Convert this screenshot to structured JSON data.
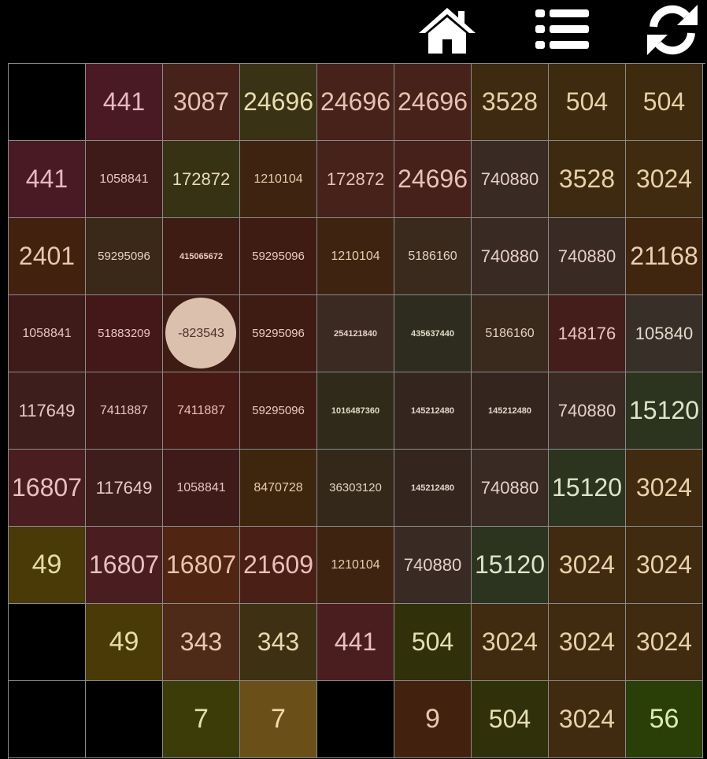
{
  "toolbar": {
    "buttons": [
      {
        "name": "home-button",
        "icon": "home-icon"
      },
      {
        "name": "menu-button",
        "icon": "list-icon"
      },
      {
        "name": "restart-button",
        "icon": "refresh-icon"
      }
    ],
    "icon_color": "#ffffff"
  },
  "board": {
    "rows": 9,
    "cols": 9,
    "selected": {
      "row": 3,
      "col": 2
    },
    "selected_color": "#dcc0ae",
    "cells": [
      [
        {
          "v": "",
          "bg": "#000000",
          "fg": "#e8c8c0"
        },
        {
          "v": "441",
          "bg": "#4a1a24",
          "fg": "#e8b8c0"
        },
        {
          "v": "3087",
          "bg": "#46221a",
          "fg": "#e8c0b0"
        },
        {
          "v": "24696",
          "bg": "#3a3214",
          "fg": "#e8dcb0"
        },
        {
          "v": "24696",
          "bg": "#46221a",
          "fg": "#e8c0b0"
        },
        {
          "v": "24696",
          "bg": "#46221a",
          "fg": "#e8c0b0"
        },
        {
          "v": "3528",
          "bg": "#3e2a10",
          "fg": "#e8d0a8"
        },
        {
          "v": "504",
          "bg": "#3e2a0e",
          "fg": "#e8d0a8"
        },
        {
          "v": "504",
          "bg": "#3e2a0e",
          "fg": "#e8d0a8"
        }
      ],
      [
        {
          "v": "441",
          "bg": "#4a1a24",
          "fg": "#e8b8c0"
        },
        {
          "v": "1058841",
          "bg": "#3e1a18",
          "fg": "#e8c4c0"
        },
        {
          "v": "172872",
          "bg": "#383214",
          "fg": "#e8dcb8"
        },
        {
          "v": "1210104",
          "bg": "#3e2410",
          "fg": "#e8ccb0"
        },
        {
          "v": "172872",
          "bg": "#46221a",
          "fg": "#e8c4b8"
        },
        {
          "v": "24696",
          "bg": "#46201a",
          "fg": "#e8c0b8"
        },
        {
          "v": "740880",
          "bg": "#3a2a24",
          "fg": "#e4d0c8"
        },
        {
          "v": "3528",
          "bg": "#3e2a10",
          "fg": "#e8d0a8"
        },
        {
          "v": "3024",
          "bg": "#402a10",
          "fg": "#e8d0a8"
        }
      ],
      [
        {
          "v": "2401",
          "bg": "#42220e",
          "fg": "#e8c8b0"
        },
        {
          "v": "59295096",
          "bg": "#3a2818",
          "fg": "#e8d0c0"
        },
        {
          "v": "415065672",
          "bg": "#3e1c14",
          "fg": "#e8c8c0"
        },
        {
          "v": "59295096",
          "bg": "#3e1c14",
          "fg": "#e8c8c0"
        },
        {
          "v": "1210104",
          "bg": "#3e2410",
          "fg": "#e8ccb0"
        },
        {
          "v": "5186160",
          "bg": "#3a2a1e",
          "fg": "#e4d0c0"
        },
        {
          "v": "740880",
          "bg": "#3a2a24",
          "fg": "#e4d0c8"
        },
        {
          "v": "740880",
          "bg": "#3a2a24",
          "fg": "#e4d0c8"
        },
        {
          "v": "21168",
          "bg": "#40260e",
          "fg": "#e8d0b0"
        }
      ],
      [
        {
          "v": "1058841",
          "bg": "#3e1a18",
          "fg": "#e8c4c0"
        },
        {
          "v": "51883209",
          "bg": "#441818",
          "fg": "#e8c4c0"
        },
        {
          "v": "-823543",
          "bg": "#3e1c14",
          "fg": "#4a3028"
        },
        {
          "v": "59295096",
          "bg": "#3e1c14",
          "fg": "#e8c8c0"
        },
        {
          "v": "254121840",
          "bg": "#3a2a22",
          "fg": "#e4d0c8"
        },
        {
          "v": "435637440",
          "bg": "#2e2c1e",
          "fg": "#e0dcc8"
        },
        {
          "v": "5186160",
          "bg": "#3a2a1e",
          "fg": "#e4d0c0"
        },
        {
          "v": "148176",
          "bg": "#441e1a",
          "fg": "#e8c4c0"
        },
        {
          "v": "105840",
          "bg": "#383028",
          "fg": "#e4d8cc"
        }
      ],
      [
        {
          "v": "117649",
          "bg": "#3e1e1c",
          "fg": "#e8c8c4"
        },
        {
          "v": "7411887",
          "bg": "#3e1a18",
          "fg": "#e8c4c0"
        },
        {
          "v": "7411887",
          "bg": "#481a16",
          "fg": "#e8c0b8"
        },
        {
          "v": "59295096",
          "bg": "#3e1c14",
          "fg": "#e8c8c0"
        },
        {
          "v": "1016487360",
          "bg": "#302a1a",
          "fg": "#e0d8c4"
        },
        {
          "v": "145212480",
          "bg": "#34261e",
          "fg": "#e4d4c8"
        },
        {
          "v": "145212480",
          "bg": "#34261e",
          "fg": "#e4d4c8"
        },
        {
          "v": "740880",
          "bg": "#3a2a24",
          "fg": "#e4d0c8"
        },
        {
          "v": "15120",
          "bg": "#2c3420",
          "fg": "#dce4c8"
        }
      ],
      [
        {
          "v": "16807",
          "bg": "#4a1e20",
          "fg": "#e8c0c0"
        },
        {
          "v": "117649",
          "bg": "#3e1e1c",
          "fg": "#e8c8c4"
        },
        {
          "v": "1058841",
          "bg": "#3e1a18",
          "fg": "#e8c4c0"
        },
        {
          "v": "8470728",
          "bg": "#3e260e",
          "fg": "#e8ccb0"
        },
        {
          "v": "36303120",
          "bg": "#34281a",
          "fg": "#e4d4c0"
        },
        {
          "v": "145212480",
          "bg": "#34261e",
          "fg": "#e4d4c8"
        },
        {
          "v": "740880",
          "bg": "#3a2a24",
          "fg": "#e4d0c8"
        },
        {
          "v": "15120",
          "bg": "#2c3420",
          "fg": "#dce4c8"
        },
        {
          "v": "3024",
          "bg": "#402a10",
          "fg": "#e8d0a8"
        }
      ],
      [
        {
          "v": "49",
          "bg": "#4a3a08",
          "fg": "#e8dca8"
        },
        {
          "v": "16807",
          "bg": "#4a1e20",
          "fg": "#e8c0c0"
        },
        {
          "v": "16807",
          "bg": "#502612",
          "fg": "#e8c4b0"
        },
        {
          "v": "21609",
          "bg": "#4a2016",
          "fg": "#e8c0b8"
        },
        {
          "v": "1210104",
          "bg": "#3e2410",
          "fg": "#e8ccb0"
        },
        {
          "v": "740880",
          "bg": "#3a2a24",
          "fg": "#e4d0c8"
        },
        {
          "v": "15120",
          "bg": "#2c3420",
          "fg": "#dce4c8"
        },
        {
          "v": "3024",
          "bg": "#402a10",
          "fg": "#e8d0a8"
        },
        {
          "v": "3024",
          "bg": "#402a10",
          "fg": "#e8d0a8"
        }
      ],
      [
        {
          "v": "",
          "bg": "#000000",
          "fg": "#e8c8c0"
        },
        {
          "v": "49",
          "bg": "#4a3a08",
          "fg": "#e8dca8"
        },
        {
          "v": "343",
          "bg": "#4e2a18",
          "fg": "#e8c8b0"
        },
        {
          "v": "343",
          "bg": "#3e3012",
          "fg": "#e8d8b0"
        },
        {
          "v": "441",
          "bg": "#4a1e1e",
          "fg": "#e8c0c0"
        },
        {
          "v": "504",
          "bg": "#30300a",
          "fg": "#e4e0b0"
        },
        {
          "v": "3024",
          "bg": "#402a10",
          "fg": "#e8d0a8"
        },
        {
          "v": "3024",
          "bg": "#402a10",
          "fg": "#e8d0a8"
        },
        {
          "v": "3024",
          "bg": "#402a10",
          "fg": "#e8d0a8"
        }
      ],
      [
        {
          "v": "",
          "bg": "#000000",
          "fg": "#e8c8c0"
        },
        {
          "v": "",
          "bg": "#000000",
          "fg": "#e8c8c0"
        },
        {
          "v": "7",
          "bg": "#3c3c08",
          "fg": "#e4e0a8"
        },
        {
          "v": "7",
          "bg": "#6a5018",
          "fg": "#f0dca8"
        },
        {
          "v": "",
          "bg": "#000000",
          "fg": "#e8c8c0"
        },
        {
          "v": "9",
          "bg": "#42220e",
          "fg": "#e8c8b0"
        },
        {
          "v": "504",
          "bg": "#30300a",
          "fg": "#e4e0b0"
        },
        {
          "v": "3024",
          "bg": "#402a10",
          "fg": "#e8d0a8"
        },
        {
          "v": "56",
          "bg": "#2a3e08",
          "fg": "#dcecb0"
        }
      ]
    ]
  }
}
